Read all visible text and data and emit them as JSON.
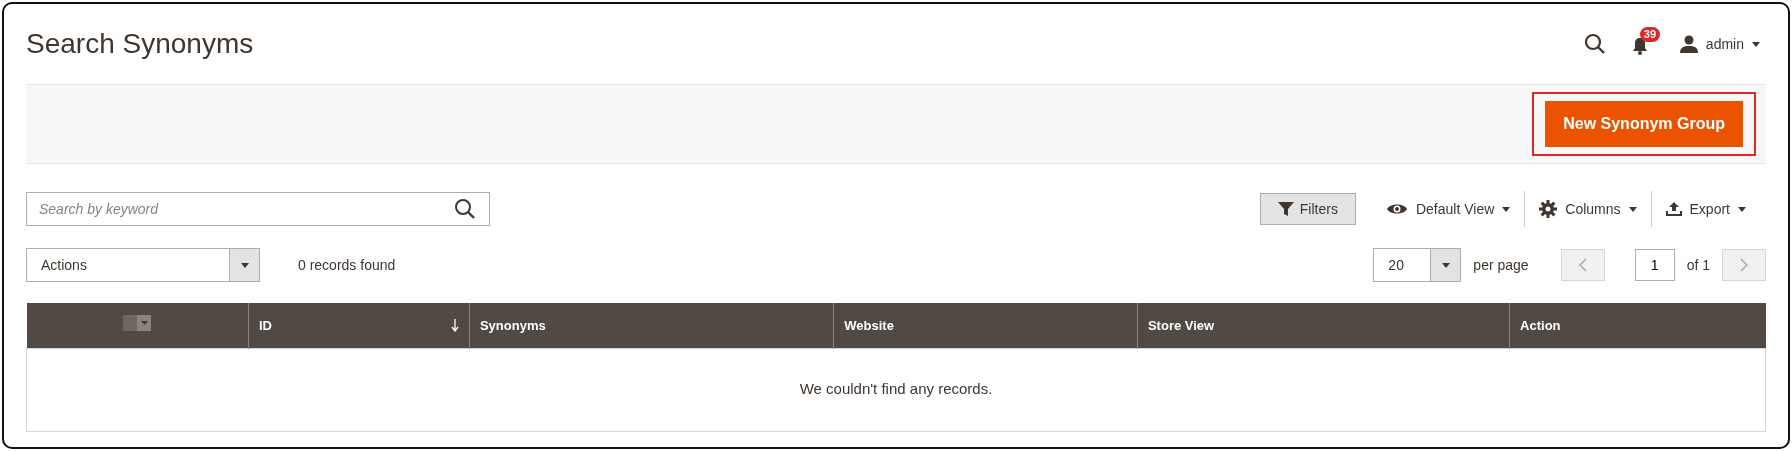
{
  "page_title": "Search Synonyms",
  "header": {
    "notification_count": "39",
    "user": "admin"
  },
  "action_button": {
    "label": "New Synonym Group",
    "highlighted": true
  },
  "search": {
    "placeholder": "Search by keyword"
  },
  "toolbar": {
    "filters": "Filters",
    "view": "Default View",
    "columns": "Columns",
    "export": "Export"
  },
  "mass_actions": {
    "value": "Actions"
  },
  "records_found": "0 records found",
  "pager": {
    "per_page_value": "20",
    "per_page_label": "per page",
    "page": "1",
    "of_pages": "of 1"
  },
  "table": {
    "columns": [
      {
        "kind": "select",
        "checked": false
      },
      {
        "label": "ID",
        "kind": "sorted"
      },
      {
        "label": "Synonyms",
        "kind": "text"
      },
      {
        "label": "Website",
        "kind": "text"
      },
      {
        "label": "Store View",
        "kind": "text"
      },
      {
        "label": "Action",
        "kind": "text"
      }
    ],
    "empty_message": "We couldn't find any records."
  }
}
